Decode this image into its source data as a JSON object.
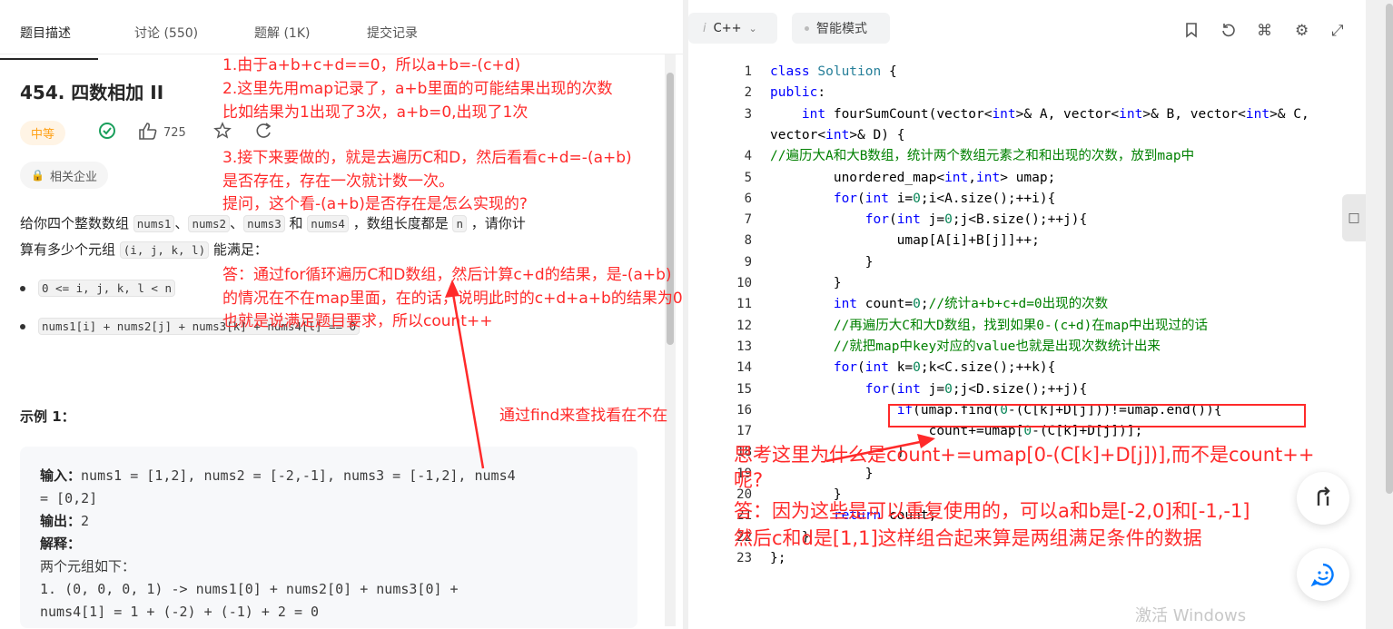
{
  "tabs": [
    "题目描述",
    "讨论 (550)",
    "题解 (1K)",
    "提交记录"
  ],
  "problem": {
    "title": "454. 四数相加 II",
    "difficulty": "中等",
    "likes": "725",
    "company_tag": "相关企业",
    "desc_part1": "给你四个整数数组 ",
    "nums1": "nums1",
    "sep": "、",
    "nums2": "nums2",
    "nums3": "nums3",
    "and": " 和 ",
    "nums4": "nums4",
    "desc_part2": " ，数组长度都是 ",
    "n": "n",
    "desc_part3": " ，请你计",
    "desc_line2_a": "算有多少个元组 ",
    "tuple": "(i, j, k, l)",
    "desc_line2_b": " 能满足：",
    "bullet1": "0 <= i, j, k, l < n",
    "bullet2": "nums1[i] + nums2[j] + nums3[k] + nums4[l] == 0",
    "example_title": "示例 1：",
    "example": {
      "input_label": "输入：",
      "input_value": "nums1 = [1,2], nums2 = [-2,-1], nums3 = [-1,2], nums4",
      "input_value2": "= [0,2]",
      "output_label": "输出：",
      "output_value": "2",
      "explain_label": "解释：",
      "explain_line1": "两个元组如下：",
      "explain_line2": "1. (0, 0, 0, 1) -> nums1[0] + nums2[0] + nums3[0] +",
      "explain_line3": "nums4[1] = 1 + (-2) + (-1) + 2 = 0"
    }
  },
  "editor": {
    "language": "C++",
    "mode": "智能模式",
    "lines": [
      {
        "n": "1",
        "segs": [
          [
            "kw",
            "class "
          ],
          [
            "ty",
            "Solution"
          ],
          [
            "",
            " {"
          ]
        ]
      },
      {
        "n": "2",
        "segs": [
          [
            "kw",
            "public"
          ],
          [
            "",
            ":"
          ]
        ]
      },
      {
        "n": "3",
        "segs": [
          [
            "",
            "    "
          ],
          [
            "kw",
            "int "
          ],
          [
            "",
            "fourSumCount(vector<"
          ],
          [
            "kw",
            "int"
          ],
          [
            "",
            ">& A, vector<"
          ],
          [
            "kw",
            "int"
          ],
          [
            "",
            ">& B, vector<"
          ],
          [
            "kw",
            "int"
          ],
          [
            "",
            ">& C,"
          ]
        ]
      },
      {
        "n": "",
        "segs": [
          [
            "",
            "vector<"
          ],
          [
            "kw",
            "int"
          ],
          [
            "",
            ">& D) {"
          ]
        ]
      },
      {
        "n": "4",
        "segs": [
          [
            "cm",
            "//遍历大A和大B数组，统计两个数组元素之和和出现的次数，放到map中"
          ]
        ]
      },
      {
        "n": "5",
        "segs": [
          [
            "",
            "        unordered_map<"
          ],
          [
            "kw",
            "int"
          ],
          [
            "",
            ","
          ],
          [
            "kw",
            "int"
          ],
          [
            "",
            "> umap;"
          ]
        ]
      },
      {
        "n": "6",
        "segs": [
          [
            "",
            "        "
          ],
          [
            "kw",
            "for"
          ],
          [
            "",
            "("
          ],
          [
            "kw",
            "int "
          ],
          [
            "",
            "i="
          ],
          [
            "num",
            "0"
          ],
          [
            "",
            ";i<A.size();++i){"
          ]
        ]
      },
      {
        "n": "7",
        "segs": [
          [
            "",
            "            "
          ],
          [
            "kw",
            "for"
          ],
          [
            "",
            "("
          ],
          [
            "kw",
            "int "
          ],
          [
            "",
            "j="
          ],
          [
            "num",
            "0"
          ],
          [
            "",
            ";j<B.size();++j){"
          ]
        ]
      },
      {
        "n": "8",
        "segs": [
          [
            "",
            "                umap[A[i]+B[j]]++;"
          ]
        ]
      },
      {
        "n": "9",
        "segs": [
          [
            "",
            "            }"
          ]
        ]
      },
      {
        "n": "10",
        "segs": [
          [
            "",
            "        }"
          ]
        ]
      },
      {
        "n": "11",
        "segs": [
          [
            "",
            "        "
          ],
          [
            "kw",
            "int "
          ],
          [
            "",
            "count="
          ],
          [
            "num",
            "0"
          ],
          [
            "",
            ";"
          ],
          [
            "cm",
            "//统计a+b+c+d=0出现的次数"
          ]
        ]
      },
      {
        "n": "12",
        "segs": [
          [
            "",
            "        "
          ],
          [
            "cm",
            "//再遍历大C和大D数组，找到如果0-(c+d)在map中出现过的话"
          ]
        ]
      },
      {
        "n": "13",
        "segs": [
          [
            "",
            "        "
          ],
          [
            "cm",
            "//就把map中key对应的value也就是出现次数统计出来"
          ]
        ]
      },
      {
        "n": "14",
        "segs": [
          [
            "",
            "        "
          ],
          [
            "kw",
            "for"
          ],
          [
            "",
            "("
          ],
          [
            "kw",
            "int "
          ],
          [
            "",
            "k="
          ],
          [
            "num",
            "0"
          ],
          [
            "",
            ";k<C.size();++k){"
          ]
        ]
      },
      {
        "n": "15",
        "segs": [
          [
            "",
            "            "
          ],
          [
            "kw",
            "for"
          ],
          [
            "",
            "("
          ],
          [
            "kw",
            "int "
          ],
          [
            "",
            "j="
          ],
          [
            "num",
            "0"
          ],
          [
            "",
            ";j<D.size();++j){"
          ]
        ]
      },
      {
        "n": "16",
        "segs": [
          [
            "",
            "                "
          ],
          [
            "kw",
            "if"
          ],
          [
            "",
            "(umap.find("
          ],
          [
            "num",
            "0"
          ],
          [
            "",
            "-(C[k]+D[j]))!=umap.end()){"
          ]
        ]
      },
      {
        "n": "17",
        "segs": [
          [
            "",
            "                    count+=umap["
          ],
          [
            "num",
            "0"
          ],
          [
            "",
            "-(C[k]+D[j])];"
          ]
        ]
      },
      {
        "n": "18",
        "segs": [
          [
            "",
            "                }"
          ]
        ]
      },
      {
        "n": "19",
        "segs": [
          [
            "",
            "            }"
          ]
        ]
      },
      {
        "n": "20",
        "segs": [
          [
            "",
            "        }"
          ]
        ]
      },
      {
        "n": "21",
        "segs": [
          [
            "",
            "        "
          ],
          [
            "kw",
            "return "
          ],
          [
            "",
            "count;"
          ]
        ]
      },
      {
        "n": "22",
        "segs": [
          [
            "",
            "    }"
          ]
        ]
      },
      {
        "n": "23",
        "segs": [
          [
            "",
            "};"
          ]
        ]
      }
    ]
  },
  "annotations": {
    "a1": "1.由于a+b+c+d==0，所以a+b=-(c+d)",
    "a2": "2.这里先用map记录了，a+b里面的可能结果出现的次数",
    "a3": "比如结果为1出现了3次，a+b=0,出现了1次",
    "a4": "3.接下来要做的，就是去遍历C和D，然后看看c+d=-(a+b)",
    "a5": "是否存在，存在一次就计数一次。",
    "a6": "提问，这个看-(a+b)是否存在是怎么实现的?",
    "a7": "答：通过for循环遍历C和D数组，然后计算c+d的结果，是-(a+b)",
    "a8": "的情况在不在map里面，在的话，说明此时的c+d+a+b的结果为0",
    "a9": "也就是说满足题目要求，所以count++",
    "a10": "通过find来查找看在不在",
    "a11": "思考这里为什么是count+=umap[0-(C[k]+D[j])],而不是count++",
    "a12": "呢?",
    "a13": "答：因为这些是可以重复使用的，可以a和b是[-2,0]和[-1,-1]",
    "a14": "然后c和d是[1,1]这样组合起来算是两组满足条件的数据"
  },
  "watermark": "激活 Windows",
  "colors": {
    "annotation": "#ff2a2a",
    "difficulty": "#ffa116",
    "keyword": "#0000ff",
    "comment": "#008000"
  }
}
